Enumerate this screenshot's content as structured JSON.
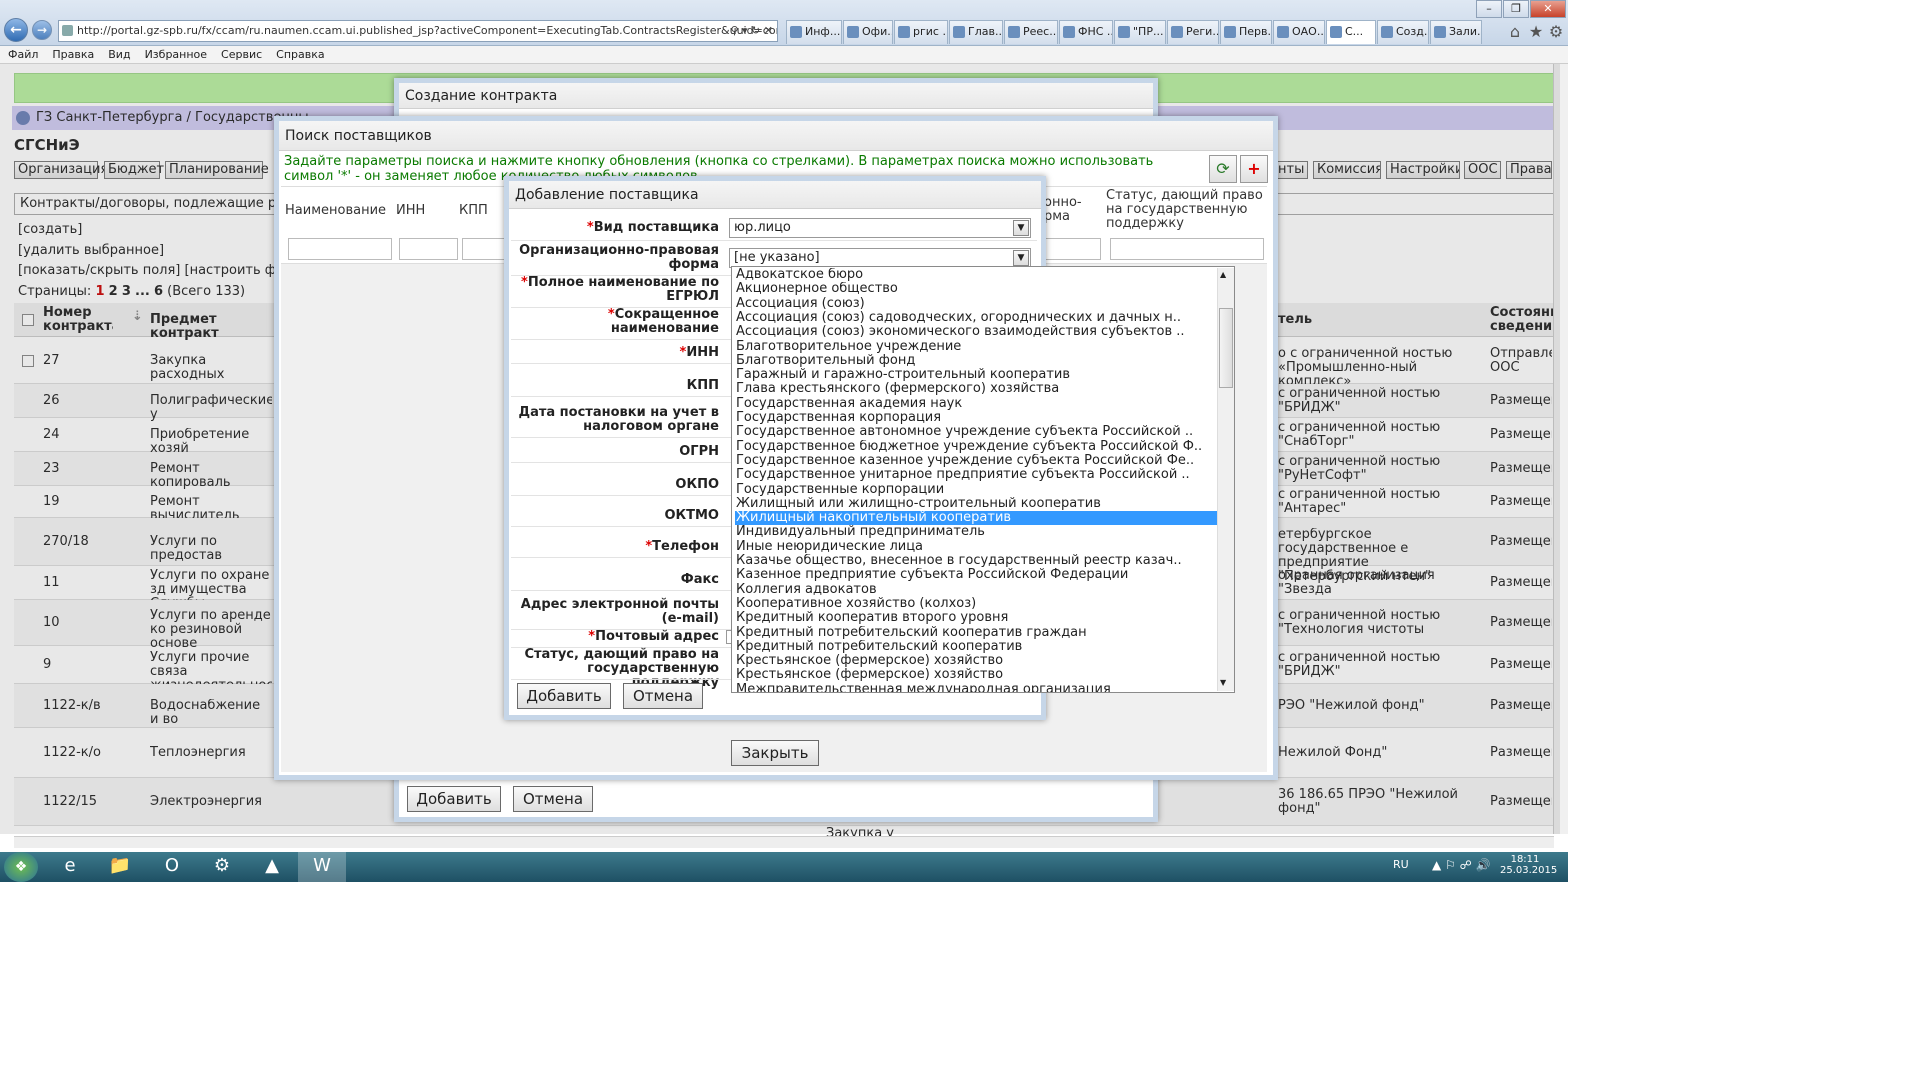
{
  "browser": {
    "url": "http://portal.gz-spb.ru/fx/ccam/ru.naumen.ccam.ui.published_jsp?activeComponent=ExecutingTab.ContractsRegister&uuid=corebofs000080000i",
    "tabs": [
      "Инф...",
      "Офи...",
      "ргис ...",
      "Глав...",
      "Реес...",
      "ФНС ...",
      "\"ПР...",
      "Реги...",
      "Перв...",
      "ОАО...",
      "С...",
      "Созд...",
      "Зали..."
    ],
    "menu": [
      "Файл",
      "Правка",
      "Вид",
      "Избранное",
      "Сервис",
      "Справка"
    ]
  },
  "app": {
    "breadcrumb": "ГЗ Санкт-Петербурга / Государственны",
    "org": "СГСНиЭ",
    "top_buttons_left": [
      "Организация",
      "Бюджет",
      "Планирование"
    ],
    "top_buttons_right": [
      "енты",
      "Комиссия",
      "Настройки",
      "ООС",
      "Права ,"
    ],
    "contract_tab": "Контракты/договоры, подлежащие регист",
    "links": {
      "create": "[создать]",
      "delete": "[удалить выбранное]",
      "fields": "[показать/скрыть поля] [настроить филь"
    },
    "pages_label": "Страницы:",
    "pages": [
      "1",
      "2",
      "3",
      "...",
      "6"
    ],
    "pages_total": "(Всего 133)",
    "columns": {
      "num": "Номер контракта",
      "subject": "Предмет контракт",
      "supplier": "тель",
      "status": "Состояние сведений"
    },
    "rows": [
      {
        "num": "27",
        "subject": "Закупка расходных",
        "supplier": "о с ограниченной ностью «Промышленно-ный комплекс»",
        "status": "Отправлен ООС",
        "checkbox": true
      },
      {
        "num": "26",
        "subject": "Полиграфические у",
        "supplier": "с ограниченной ностью \"БРИДЖ\"",
        "status": "Размещен"
      },
      {
        "num": "24",
        "subject": "Приобретение хозяй",
        "supplier": "с ограниченной ностью \"СнабТорг\"",
        "status": "Размещен"
      },
      {
        "num": "23",
        "subject": "Ремонт копироваль",
        "supplier": "с ограниченной ностью \"РуНетСофт\"",
        "status": "Размещен"
      },
      {
        "num": "19",
        "subject": "Ремонт вычислитель",
        "supplier": "с ограниченной ностью \"Антарес\"",
        "status": "Размещен"
      },
      {
        "num": "270/18",
        "subject": "Услуги по предостав",
        "supplier": "етербургское государственное е предприятие \"Петербургский нтен\"",
        "status": "Размещен"
      },
      {
        "num": "11",
        "subject": "Услуги по охране зд имущества Службы",
        "supplier": "охранная организация \"Звезда",
        "status": "Размещен"
      },
      {
        "num": "10",
        "subject": "Услуги по аренде ко резиновой основе",
        "supplier": "с ограниченной ностью \"Технология чистоты",
        "status": "Размещен"
      },
      {
        "num": "9",
        "subject": "Услуги прочие связа жизнедеятельности",
        "supplier": "с ограниченной ностью \"БРИДЖ\"",
        "status": "Размещен"
      },
      {
        "num": "1122-к/в",
        "subject": "Водоснабжение и во",
        "supplier": "РЭО \"Нежилой фонд\"",
        "status": "Размещен"
      },
      {
        "num": "1122-к/о",
        "subject": "Теплоэнергия",
        "supplier": "Нежилой Фонд\"",
        "status": "Размещен"
      },
      {
        "num": "1122/15",
        "subject": "Электроэнергия",
        "supplier": "36 186.65  ПРЭО \"Нежилой фонд\"",
        "status": "Размещен"
      }
    ],
    "bottom_text": "Закупка у"
  },
  "dlg_contract": {
    "title": "Создание контракта",
    "add": "Добавить",
    "cancel": "Отмена"
  },
  "dlg_search": {
    "title": "Поиск поставщиков",
    "hint": "Задайте параметры поиска и нажмите кнопку обновления (кнопка со стрелками). В параметрах поиска можно использовать символ '*' - он заменяет любое количество любых символов",
    "cols": [
      "Наименование",
      "ИНН",
      "КПП",
      "онно-рма",
      "Статус, дающий право на государственную поддержку"
    ],
    "close": "Закрыть"
  },
  "dlg_supplier": {
    "title": "Добавление поставщика",
    "fields": [
      {
        "label": "Вид поставщика",
        "req": true
      },
      {
        "label": "Организационно-правовая форма",
        "req": false
      },
      {
        "label": "Полное наименование по ЕГРЮЛ",
        "req": true
      },
      {
        "label": "Сокращенное наименование",
        "req": true
      },
      {
        "label": "ИНН",
        "req": true
      },
      {
        "label": "КПП",
        "req": false
      },
      {
        "label": "Дата постановки на учет в налоговом органе",
        "req": false
      },
      {
        "label": "ОГРН",
        "req": false
      },
      {
        "label": "ОКПО",
        "req": false
      },
      {
        "label": "ОКТМО",
        "req": false
      },
      {
        "label": "Телефон",
        "req": true
      },
      {
        "label": "Факс",
        "req": false
      },
      {
        "label": "Адрес электронной почты (e-mail)",
        "req": false
      },
      {
        "label": "Почтовый адрес",
        "req": true
      },
      {
        "label": "Статус, дающий право на государственную поддержку",
        "req": false
      }
    ],
    "type_value": "юр.лицо",
    "form_value": "[не указано]",
    "add": "Добавить",
    "cancel": "Отмена",
    "options": [
      "Адвокатское бюро",
      "Акционерное общество",
      "Ассоциация (союз)",
      "Ассоциация (союз) садоводческих, огороднических и дачных н..",
      "Ассоциация (союз) экономического взаимодействия субъектов ..",
      "Благотворительное учреждение",
      "Благотворительный фонд",
      "Гаражный и гаражно-строительный кооператив",
      "Глава крестьянского (фермерского) хозяйства",
      "Государственная академия наук",
      "Государственная корпорация",
      "Государственное автономное учреждение субъекта Российской ..",
      "Государственное бюджетное учреждение субъекта Российской Ф..",
      "Государственное казенное учреждение субъекта Российской Фе..",
      "Государственное унитарное предприятие субъекта Российской ..",
      "Государственные корпорации",
      "Жилищный или жилищно-строительный кооператив",
      "Жилищный накопительный кооператив",
      "Индивидуальный предприниматель",
      "Иные неюридические лица",
      "Казачье общество, внесенное в государственный реестр казач..",
      "Казенное предприятие субъекта Российской Федерации",
      "Коллегия адвокатов",
      "Кооперативное хозяйство (колхоз)",
      "Кредитный кооператив второго уровня",
      "Кредитный потребительский кооператив граждан",
      "Кредитный потребительский кооператив",
      "Крестьянское (фермерское) хозяйство",
      "Крестьянское (фермерское) хозяйство",
      "Межправительственная международная организация"
    ],
    "selected_option": "Жилищный накопительный кооператив"
  },
  "taskbar": {
    "lang": "RU",
    "time": "18:11",
    "date": "25.03.2015"
  },
  "colors": {
    "green_bar": "#b9f0a0",
    "crumb": "#d0ccf2",
    "selection": "#3399ff",
    "hint": "#0a7a00"
  }
}
